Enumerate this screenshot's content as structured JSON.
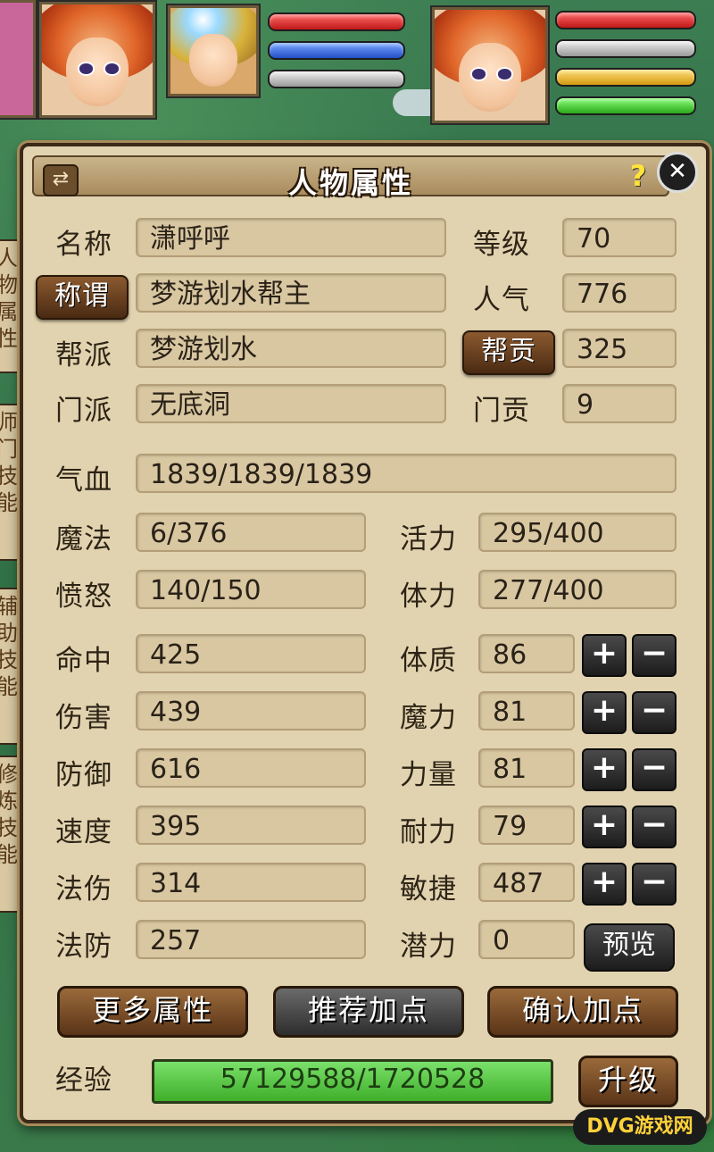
{
  "window": {
    "title": "人物属性",
    "switch_glyph": "⇄",
    "help_glyph": "?",
    "close_glyph": "✕"
  },
  "hud": {
    "player": {
      "hp_level": 0.95,
      "mp_level": 0.95
    },
    "pet": {
      "hp_level": 0.95,
      "mp_level": 0.9
    }
  },
  "side_tabs": [
    "人物属性",
    "师门技能",
    "辅助技能",
    "修炼技能"
  ],
  "info": {
    "name_label": "名称",
    "name_value": "潇呼呼",
    "level_label": "等级",
    "level_value": "70",
    "title_button": "称谓",
    "title_value": "梦游划水帮主",
    "popularity_label": "人气",
    "popularity_value": "776",
    "guild_label": "帮派",
    "guild_value": "梦游划水",
    "guild_contrib_button": "帮贡",
    "guild_contrib_value": "325",
    "sect_label": "门派",
    "sect_value": "无底洞",
    "sect_contrib_label": "门贡",
    "sect_contrib_value": "9"
  },
  "stats": {
    "hp_label": "气血",
    "hp_value": "1839/1839/1839",
    "mp_label": "魔法",
    "mp_value": "6/376",
    "vitality_label": "活力",
    "vitality_value": "295/400",
    "rage_label": "愤怒",
    "rage_value": "140/150",
    "stamina_label": "体力",
    "stamina_value": "277/400",
    "hit_label": "命中",
    "hit_value": "425",
    "damage_label": "伤害",
    "damage_value": "439",
    "defense_label": "防御",
    "defense_value": "616",
    "speed_label": "速度",
    "speed_value": "395",
    "magic_damage_label": "法伤",
    "magic_damage_value": "314",
    "magic_defense_label": "法防",
    "magic_defense_value": "257"
  },
  "attributes": [
    {
      "label": "体质",
      "value": "86"
    },
    {
      "label": "魔力",
      "value": "81"
    },
    {
      "label": "力量",
      "value": "81"
    },
    {
      "label": "耐力",
      "value": "79"
    },
    {
      "label": "敏捷",
      "value": "487"
    }
  ],
  "potential": {
    "label": "潜力",
    "value": "0",
    "preview_button": "预览"
  },
  "plus_glyph": "+",
  "minus_glyph": "−",
  "buttons": {
    "more_attributes": "更多属性",
    "recommend_points": "推荐加点",
    "confirm_points": "确认加点",
    "level_up": "升级"
  },
  "experience": {
    "label": "经验",
    "value": "57129588/1720528"
  },
  "watermark": {
    "text": "DVG游戏网"
  },
  "colors": {
    "accent_button": "#5a3418",
    "exp_bar": "#3fae2a",
    "panel_bg": "#e2d3b0"
  }
}
